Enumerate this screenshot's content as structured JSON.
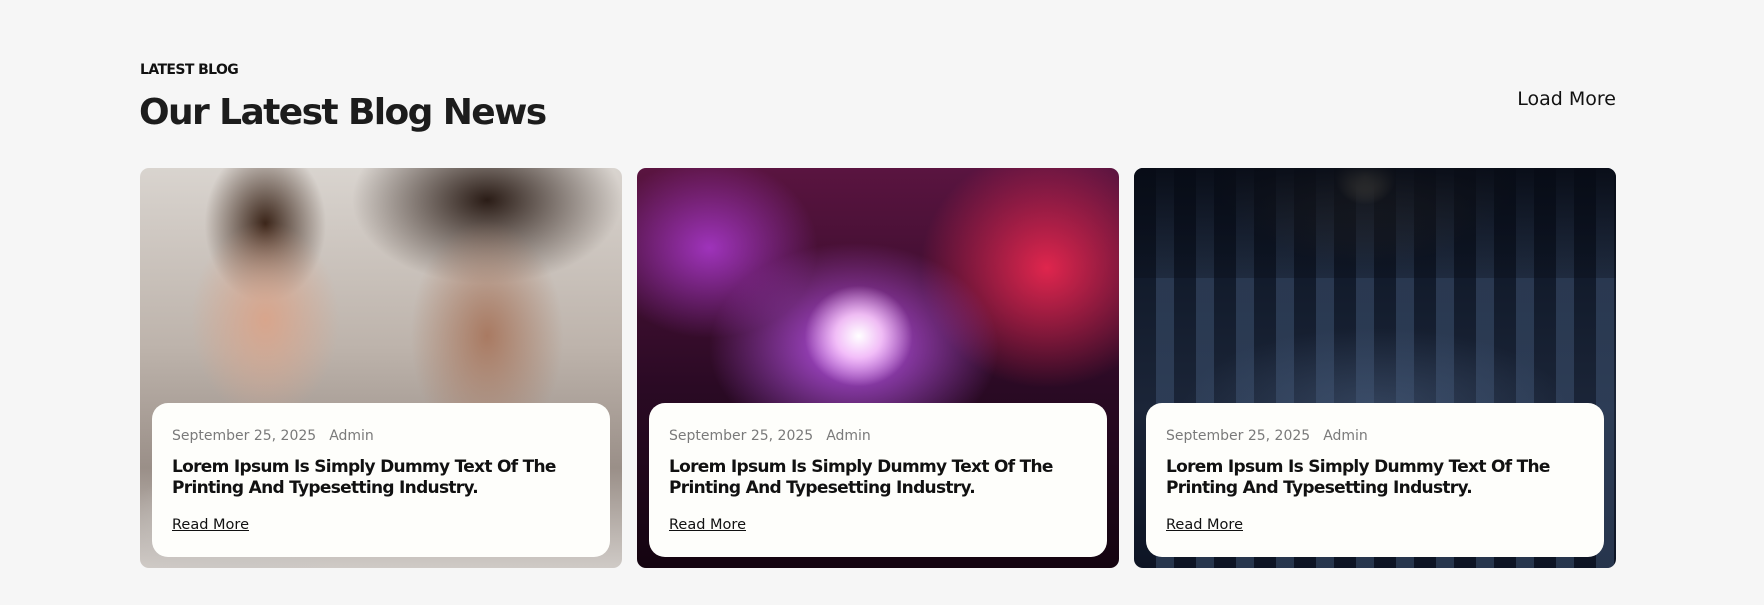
{
  "section": {
    "eyebrow": "LATEST BLOG",
    "heading": "Our Latest Blog News",
    "load_more": "Load More"
  },
  "posts": [
    {
      "image": "couple-watching-screen-photo",
      "date": "September 25, 2025",
      "author": "Admin",
      "title": "Lorem Ipsum Is Simply Dummy Text Of The Printing And Typesetting Industry.",
      "link": "Read More"
    },
    {
      "image": "concert-crowd-photo",
      "date": "September 25, 2025",
      "author": "Admin",
      "title": "Lorem Ipsum Is Simply Dummy Text Of The Printing And Typesetting Industry.",
      "link": "Read More"
    },
    {
      "image": "cinema-audience-photo",
      "date": "September 25, 2025",
      "author": "Admin",
      "title": "Lorem Ipsum Is Simply Dummy Text Of The Printing And Typesetting Industry.",
      "link": "Read More"
    }
  ],
  "colors": {
    "page_background": "#f6f6f6",
    "card_body": "#fefefb",
    "text": "#111111",
    "meta_text": "#7a7a7a"
  }
}
